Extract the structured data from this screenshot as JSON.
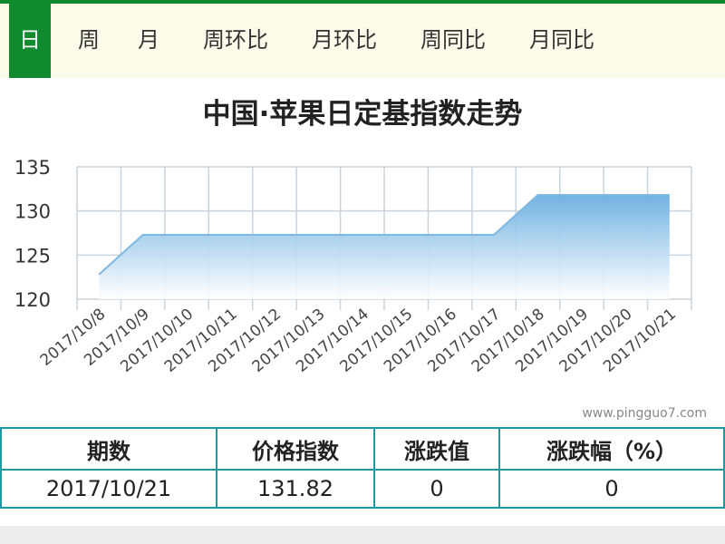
{
  "tabs": [
    {
      "label": "日",
      "active": true
    },
    {
      "label": "周",
      "active": false
    },
    {
      "label": "月",
      "active": false
    },
    {
      "label": "周环比",
      "active": false
    },
    {
      "label": "月环比",
      "active": false
    },
    {
      "label": "周同比",
      "active": false
    },
    {
      "label": "月同比",
      "active": false
    }
  ],
  "watermark": "www.pingguo7.com",
  "chart_data": {
    "type": "area",
    "title": "中国·苹果日定基指数走势",
    "xlabel": "",
    "ylabel": "",
    "categories": [
      "2017/10/8",
      "2017/10/9",
      "2017/10/10",
      "2017/10/11",
      "2017/10/12",
      "2017/10/13",
      "2017/10/14",
      "2017/10/15",
      "2017/10/16",
      "2017/10/17",
      "2017/10/18",
      "2017/10/19",
      "2017/10/20",
      "2017/10/21"
    ],
    "values": [
      122.8,
      127.3,
      127.3,
      127.3,
      127.3,
      127.3,
      127.3,
      127.3,
      127.3,
      127.3,
      131.82,
      131.82,
      131.82,
      131.82
    ],
    "ylim": [
      120,
      135
    ],
    "yticks": [
      120,
      125,
      130,
      135
    ],
    "grid": true,
    "fill_color_top": "#6aaee0",
    "fill_color_bottom": "#ffffff",
    "line_color": "#7fb7e3"
  },
  "summary": {
    "headers": [
      "期数",
      "价格指数",
      "涨跌值",
      "涨跌幅（%）"
    ],
    "rows": [
      [
        "2017/10/21",
        "131.82",
        "0",
        "0"
      ]
    ]
  }
}
